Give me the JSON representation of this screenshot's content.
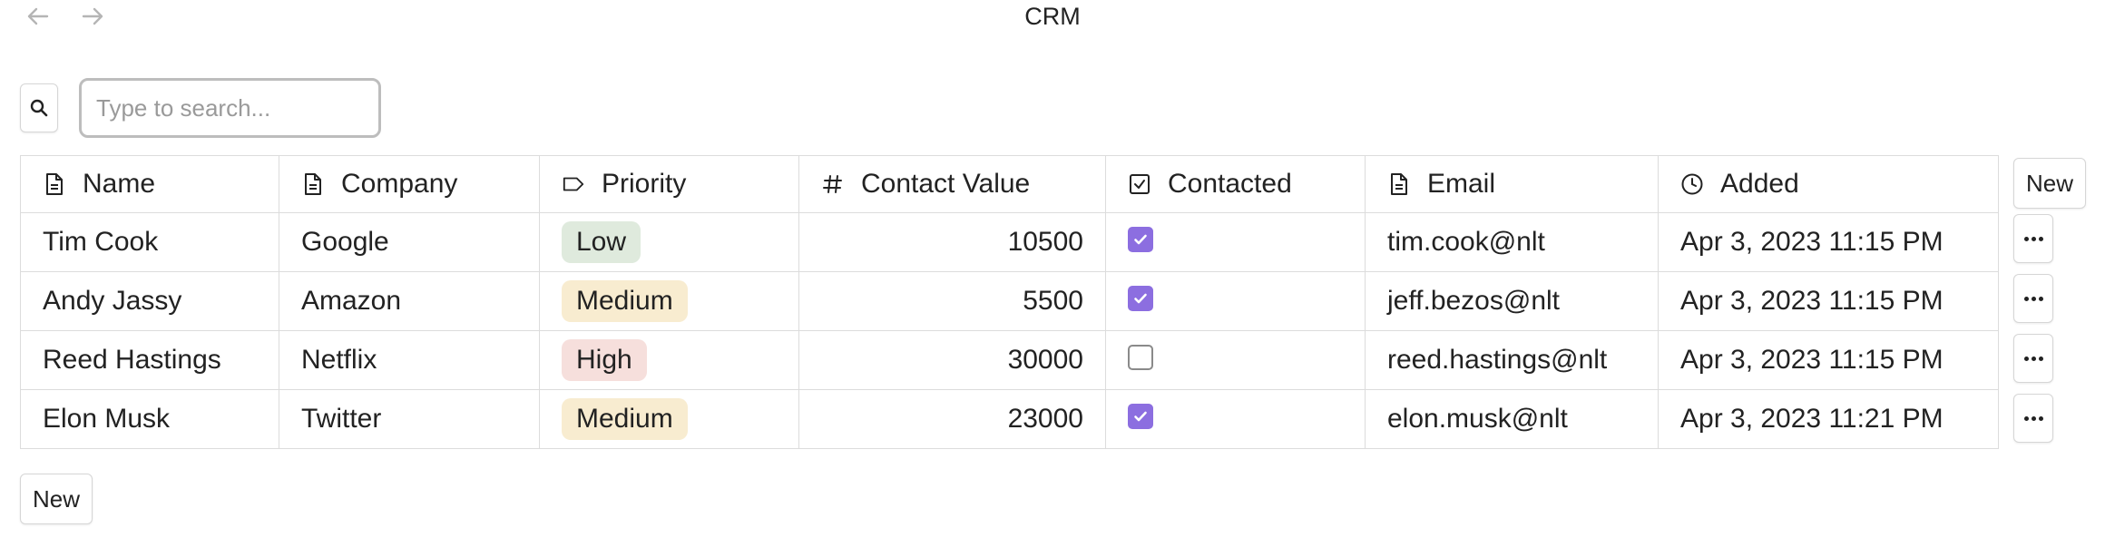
{
  "window": {
    "title": "CRM"
  },
  "search": {
    "placeholder": "Type to search..."
  },
  "table": {
    "columns": [
      {
        "label": "Name",
        "icon": "document-icon"
      },
      {
        "label": "Company",
        "icon": "document-icon"
      },
      {
        "label": "Priority",
        "icon": "tag-icon"
      },
      {
        "label": "Contact Value",
        "icon": "hash-icon"
      },
      {
        "label": "Contacted",
        "icon": "checkbox-icon"
      },
      {
        "label": "Email",
        "icon": "document-icon"
      },
      {
        "label": "Added",
        "icon": "clock-icon"
      }
    ],
    "rows": [
      {
        "name": "Tim Cook",
        "company": "Google",
        "priority": "Low",
        "value": "10500",
        "contacted": true,
        "email": "tim.cook@nlt",
        "added": "Apr 3, 2023 11:15 PM"
      },
      {
        "name": "Andy Jassy",
        "company": "Amazon",
        "priority": "Medium",
        "value": "5500",
        "contacted": true,
        "email": "jeff.bezos@nlt",
        "added": "Apr 3, 2023 11:15 PM"
      },
      {
        "name": "Reed Hastings",
        "company": "Netflix",
        "priority": "High",
        "value": "30000",
        "contacted": false,
        "email": "reed.hastings@nlt",
        "added": "Apr 3, 2023 11:15 PM"
      },
      {
        "name": "Elon Musk",
        "company": "Twitter",
        "priority": "Medium",
        "value": "23000",
        "contacted": true,
        "email": "elon.musk@nlt",
        "added": "Apr 3, 2023 11:21 PM"
      }
    ]
  },
  "buttons": {
    "new_column": "New",
    "new_row": "New"
  },
  "colors": {
    "checkbox_accent": "#8c6ee0",
    "tag_low": "#dfeadd",
    "tag_medium": "#f8ecd0",
    "tag_high": "#f6dfdc"
  }
}
